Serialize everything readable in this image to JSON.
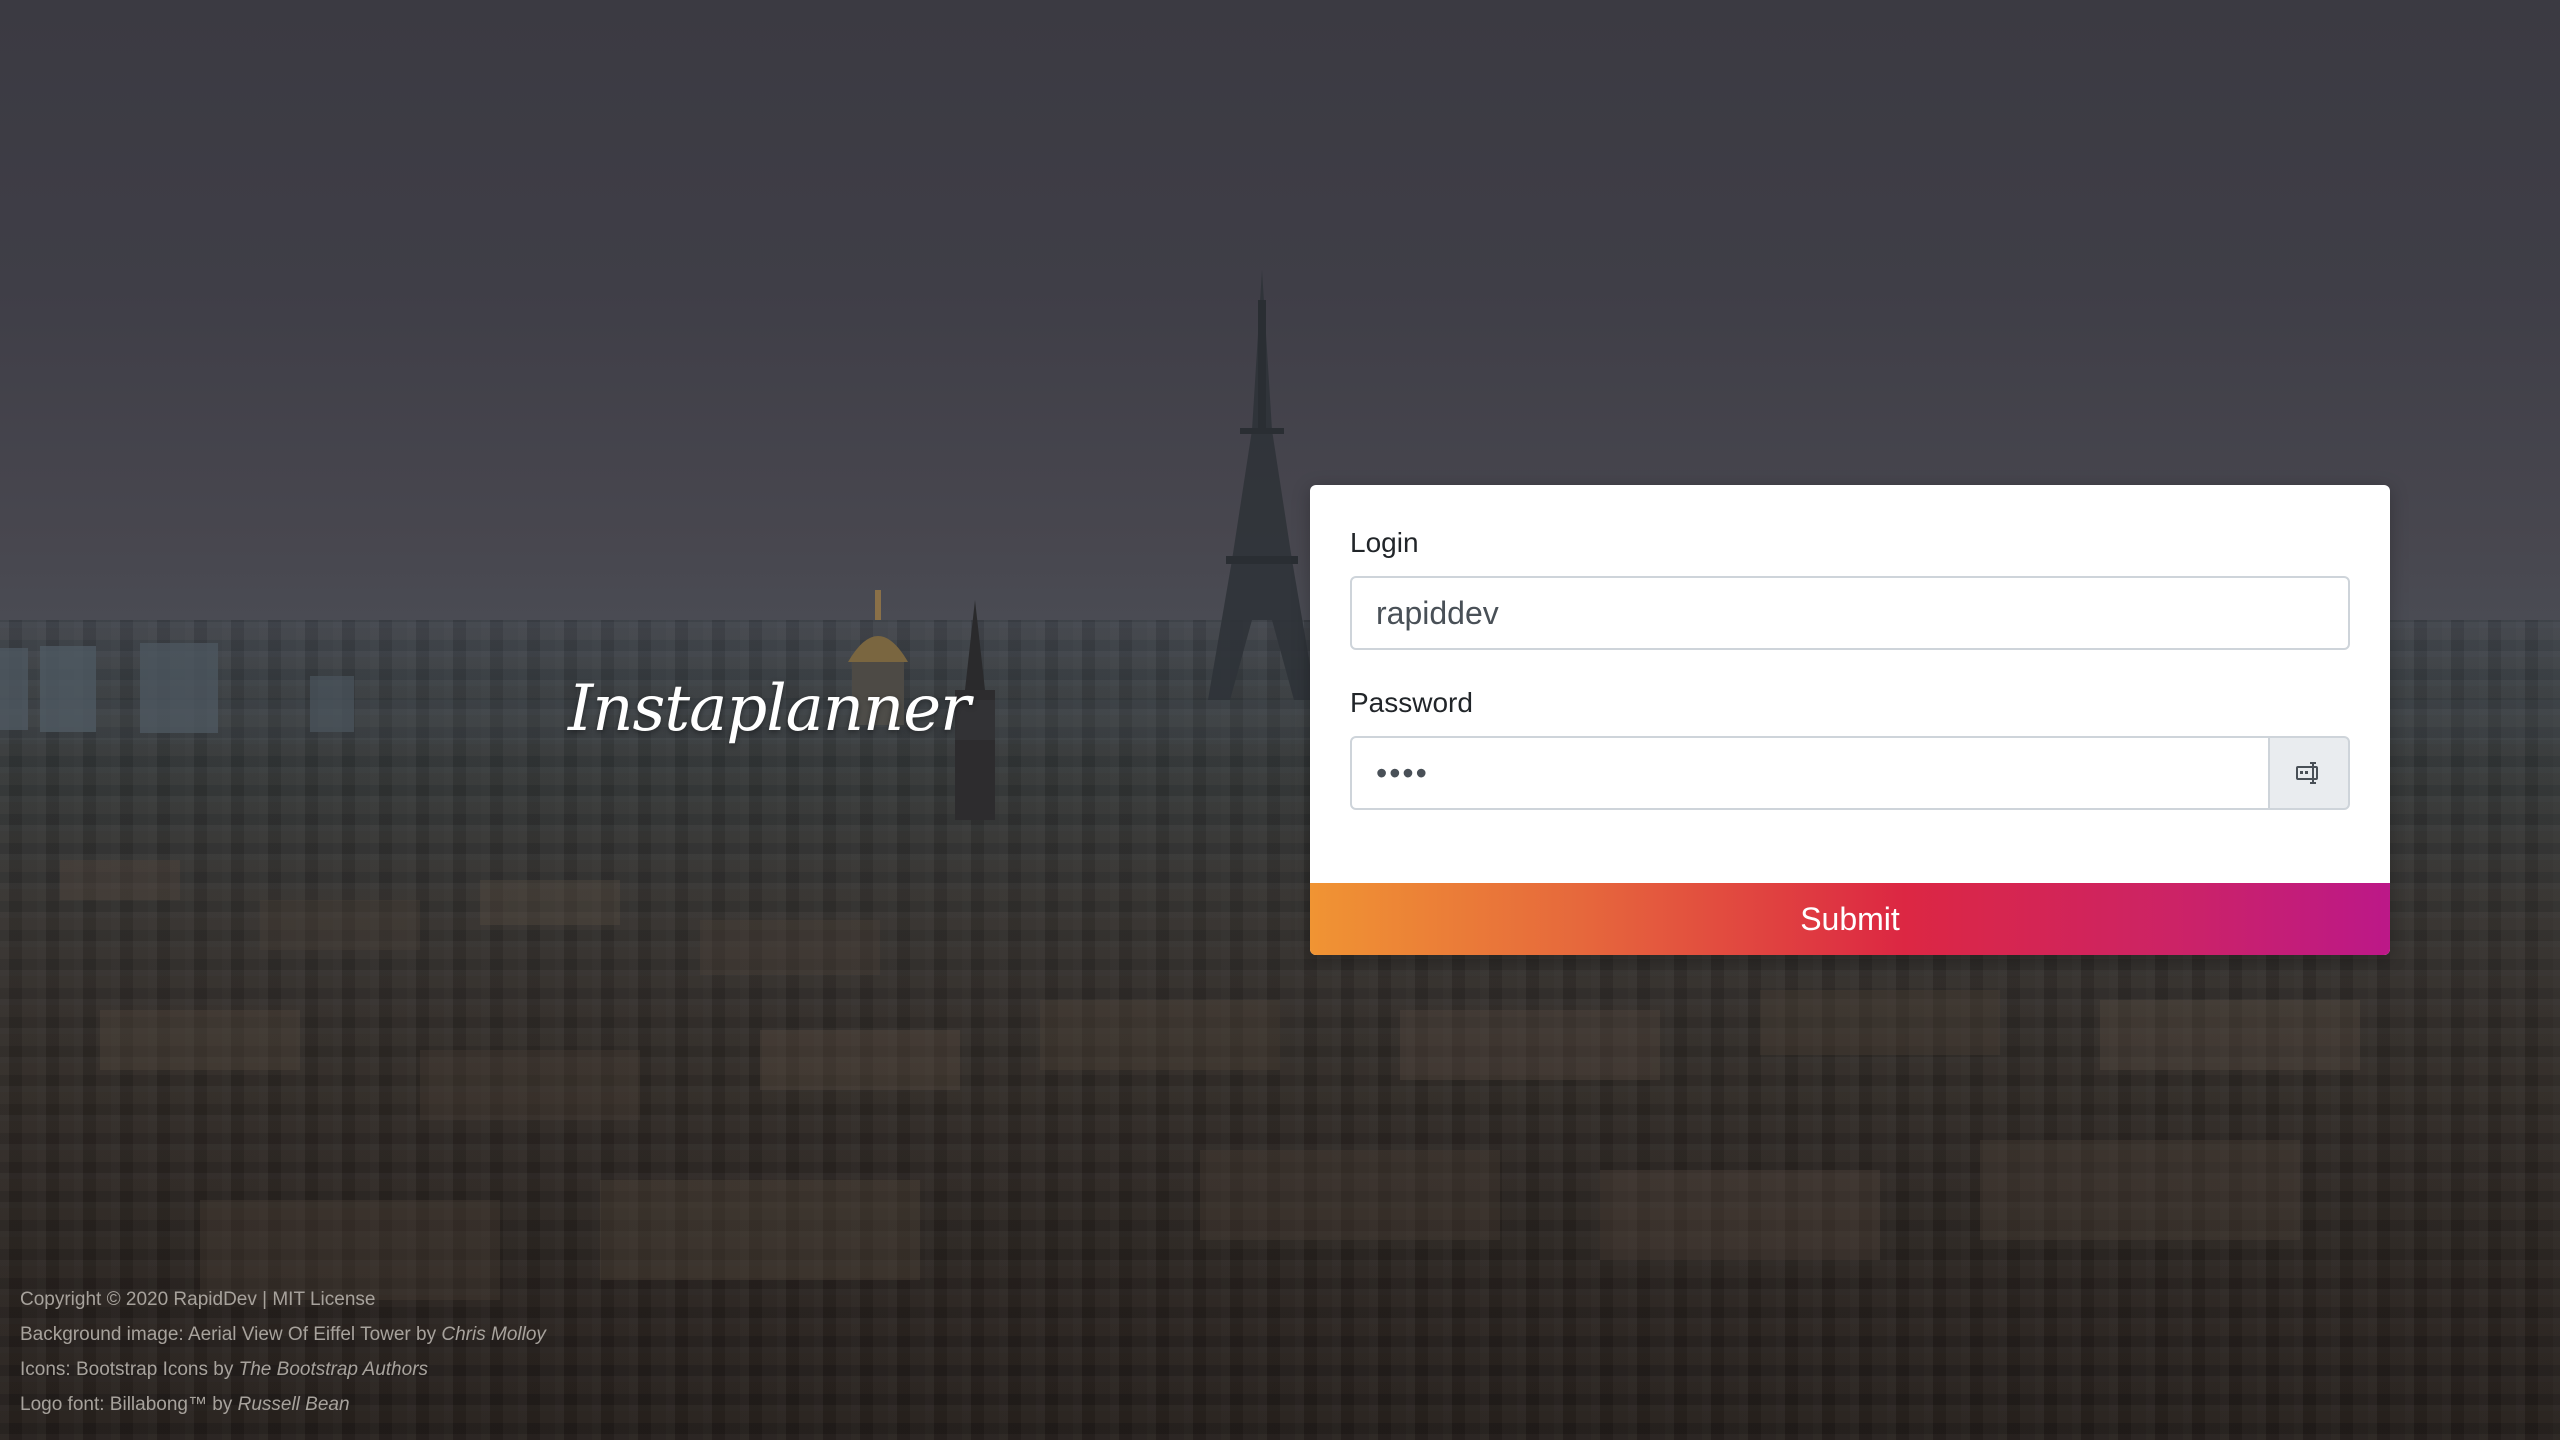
{
  "app": {
    "logo_text": "Instaplanner"
  },
  "login_form": {
    "login_label": "Login",
    "login_value": "rapiddev",
    "password_label": "Password",
    "password_value": "••••",
    "toggle_icon": "keyboard-input-icon",
    "submit_label": "Submit"
  },
  "footer": {
    "copyright": "Copyright © 2020 RapidDev | MIT License",
    "background_prefix": "Background image: Aerial View Of Eiffel Tower by ",
    "background_author": "Chris Molloy",
    "icons_prefix": "Icons: Bootstrap Icons by ",
    "icons_author": "The Bootstrap Authors",
    "font_prefix": "Logo font: Billabong™ by ",
    "font_author": "Russell Bean"
  },
  "colors": {
    "submit_gradient_start": "#f09433",
    "submit_gradient_end": "#bc1888",
    "card_background": "#ffffff",
    "input_border": "#ced4da"
  }
}
